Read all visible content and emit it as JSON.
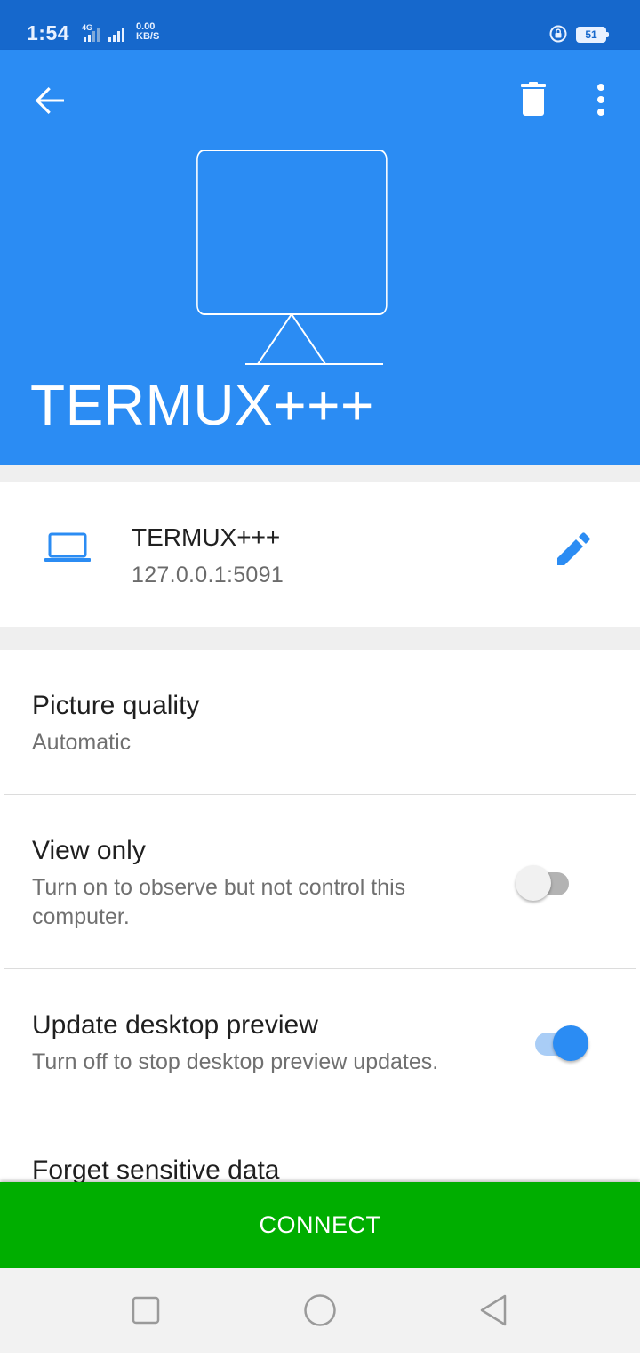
{
  "status_bar": {
    "time": "1:54",
    "network": "4G",
    "speed_value": "0.00",
    "speed_unit": "KB/S",
    "battery": "51"
  },
  "header": {
    "title": "TERMUX+++",
    "icons": [
      "back-arrow-icon",
      "delete-icon",
      "more-vert-icon",
      "monitor-icon"
    ],
    "background_color": "#2b8cf3"
  },
  "connection": {
    "name": "TERMUX+++",
    "address": "127.0.0.1:5091",
    "icons": [
      "laptop-icon",
      "edit-pencil-icon"
    ]
  },
  "settings": [
    {
      "title": "Picture quality",
      "subtitle": "Automatic"
    },
    {
      "title": "View only",
      "subtitle": "Turn on to observe but not control this computer.",
      "toggle": false
    },
    {
      "title": "Update desktop preview",
      "subtitle": "Turn off to stop desktop preview updates.",
      "toggle": true
    },
    {
      "title": "Forget sensitive data"
    }
  ],
  "connect_button": {
    "label": "CONNECT",
    "color": "#00ae00"
  },
  "nav_bar": {
    "icons": [
      "recents-square-icon",
      "home-circle-icon",
      "back-triangle-icon"
    ]
  }
}
